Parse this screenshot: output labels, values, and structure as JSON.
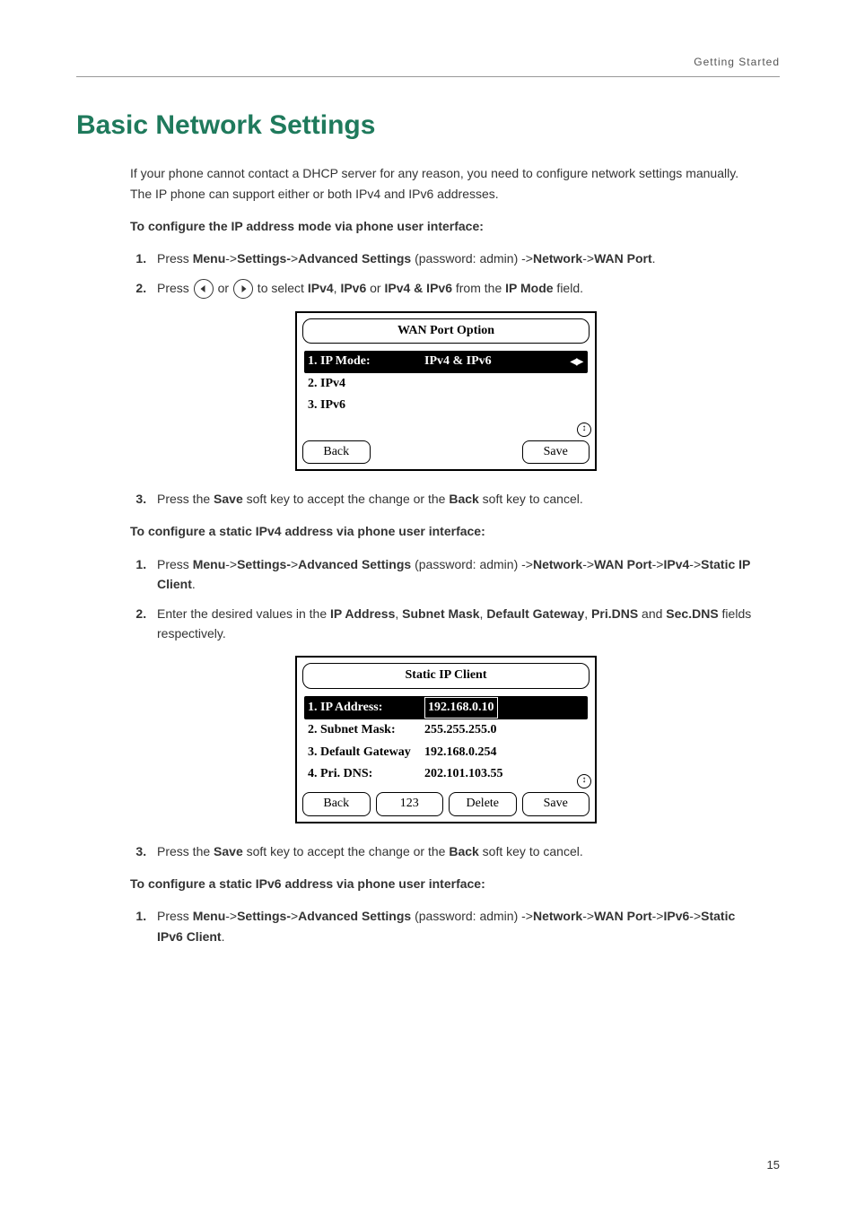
{
  "header": "Getting Started",
  "title": "Basic Network Settings",
  "intro": "If your phone cannot contact a DHCP server for any reason, you need to configure network settings manually. The IP phone can support either or both IPv4 and IPv6 addresses.",
  "sec1": {
    "heading": "To configure the IP address mode via phone user interface:",
    "step1_a": "Press ",
    "step1_b": "Menu",
    "step1_c": "->",
    "step1_d": "Settings-",
    "step1_e": ">",
    "step1_f": "Advanced Settings",
    "step1_g": " (password: admin) ->",
    "step1_h": "Network",
    "step1_i": "->",
    "step1_j": "WAN Port",
    "step1_k": ".",
    "step2_a": "Press ",
    "step2_b": " or ",
    "step2_c": " to select ",
    "step2_d": "IPv4",
    "step2_e": ", ",
    "step2_f": "IPv6",
    "step2_g": " or ",
    "step2_h": "IPv4 & IPv6",
    "step2_i": " from the ",
    "step2_j": "IP Mode",
    "step2_k": " field.",
    "step3_a": "Press the ",
    "step3_b": "Save",
    "step3_c": " soft key to accept the change or the ",
    "step3_d": "Back",
    "step3_e": " soft key to cancel."
  },
  "screen1": {
    "title": "WAN Port Option",
    "rows": [
      {
        "k": "1.  IP Mode:",
        "v": "IPv4 & IPv6",
        "sel": true,
        "arrows": true
      },
      {
        "k": "2.  IPv4",
        "v": ""
      },
      {
        "k": "3.  IPv6",
        "v": ""
      }
    ],
    "softkeys": [
      "Back",
      "",
      "",
      "Save"
    ],
    "scroll_glyph": "↕"
  },
  "sec2": {
    "heading": "To configure a static IPv4 address via phone user interface:",
    "step1_a": "Press ",
    "step1_b": "Menu",
    "step1_c": "->",
    "step1_d": "Settings-",
    "step1_e": ">",
    "step1_f": "Advanced Settings",
    "step1_g": " (password: admin) ->",
    "step1_h": "Network",
    "step1_i": "->",
    "step1_j": "WAN Port",
    "step1_k": "->",
    "step1_l": "IPv4",
    "step1_m": "->",
    "step1_n": "Static IP Client",
    "step1_o": ".",
    "step2_a": "Enter the desired values in the ",
    "step2_b": "IP Address",
    "step2_c": ", ",
    "step2_d": "Subnet Mask",
    "step2_e": ", ",
    "step2_f": "Default Gateway",
    "step2_g": ", ",
    "step2_h": "Pri.DNS",
    "step2_i": " and ",
    "step2_j": "Sec.DNS",
    "step2_k": " fields respectively.",
    "step3_a": "Press the ",
    "step3_b": "Save",
    "step3_c": " soft key to accept the change or the ",
    "step3_d": "Back",
    "step3_e": " soft key to cancel."
  },
  "screen2": {
    "title": "Static IP Client",
    "rows": [
      {
        "k": "1.  IP Address:",
        "v": "192.168.0.10",
        "sel": true,
        "box": true
      },
      {
        "k": "2.  Subnet Mask:",
        "v": "255.255.255.0"
      },
      {
        "k": "3.  Default Gateway",
        "v": "192.168.0.254"
      },
      {
        "k": "4.  Pri. DNS:",
        "v": "202.101.103.55"
      }
    ],
    "softkeys": [
      "Back",
      "123",
      "Delete",
      "Save"
    ],
    "scroll_glyph": "↕"
  },
  "sec3": {
    "heading": "To configure a static IPv6 address via phone user interface:",
    "step1_a": "Press ",
    "step1_b": "Menu",
    "step1_c": "->",
    "step1_d": "Settings-",
    "step1_e": ">",
    "step1_f": "Advanced Settings",
    "step1_g": " (password: admin) ->",
    "step1_h": "Network",
    "step1_i": "->",
    "step1_j": "WAN Port",
    "step1_k": "->",
    "step1_l": "IPv6",
    "step1_m": "->",
    "step1_n": "Static IPv6 Client",
    "step1_o": "."
  },
  "page_number": "15"
}
